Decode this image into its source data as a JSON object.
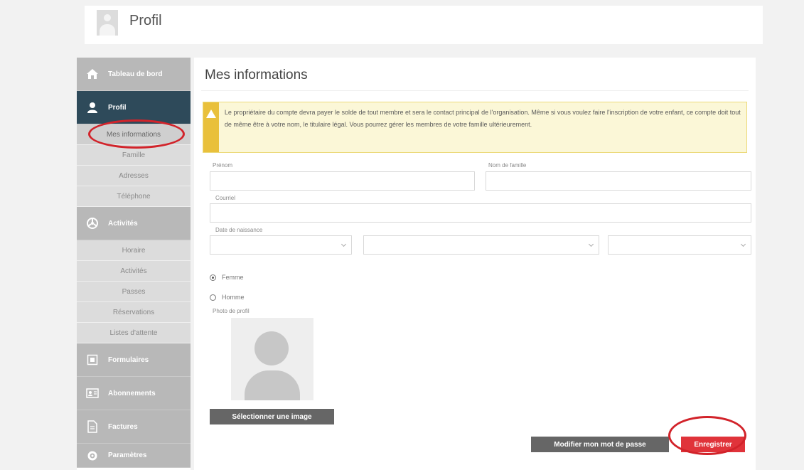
{
  "header": {
    "title": "Profil"
  },
  "sidebar": {
    "items": [
      {
        "label": "Tableau de bord",
        "icon": "home-icon"
      },
      {
        "label": "Profil",
        "icon": "user-icon",
        "subitems": [
          "Mes informations",
          "Famille",
          "Adresses",
          "Téléphone"
        ]
      },
      {
        "label": "Activités",
        "icon": "activities-icon",
        "subitems": [
          "Horaire",
          "Activités",
          "Passes",
          "Réservations",
          "Listes d'attente"
        ]
      },
      {
        "label": "Formulaires",
        "icon": "form-icon"
      },
      {
        "label": "Abonnements",
        "icon": "membership-card-icon"
      },
      {
        "label": "Factures",
        "icon": "invoice-icon"
      },
      {
        "label": "Paramètres",
        "icon": "settings-icon"
      }
    ]
  },
  "main": {
    "title": "Mes informations",
    "alert": "Le propriétaire du compte devra payer le solde de tout membre et sera le contact principal de l'organisation. Même si vous voulez faire l'inscription de votre enfant, ce compte doit tout de même être à votre nom, le titulaire légal. Vous pourrez gérer les membres de votre famille ultérieurement.",
    "form": {
      "first_name_label": "Prénom",
      "first_name_value": "",
      "last_name_label": "Nom de famille",
      "last_name_value": "",
      "email_label": "Courriel",
      "email_value": "",
      "birthdate_label": "Date de naissance",
      "gender_options": [
        "Femme",
        "Homme"
      ],
      "gender_selected": "Femme",
      "photo_label": "Photo de profil",
      "select_image_button": "Sélectionner une image"
    },
    "buttons": {
      "change_password": "Modifier mon mot de passe",
      "save": "Enregistrer"
    }
  },
  "colors": {
    "sidebar_active": "#2e4a5a",
    "sidebar_inactive": "#b8b8b8",
    "alert_accent": "#e9c03b",
    "save_button": "#e0333a",
    "annotation": "#d2232a"
  }
}
